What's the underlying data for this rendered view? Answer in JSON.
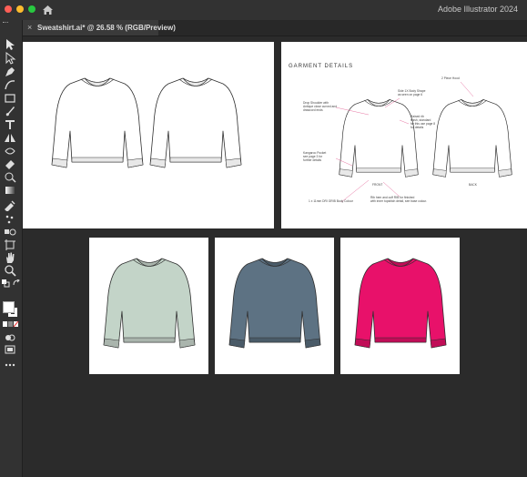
{
  "app": {
    "title": "Adobe Illustrator 2024"
  },
  "window": {
    "traffic_lights": [
      "close-red",
      "minimize-yellow",
      "zoom-green"
    ],
    "home_icon": "home-icon"
  },
  "tab": {
    "close_glyph": "×",
    "label": "Sweatshirt.ai* @ 26.58 % (RGB/Preview)"
  },
  "tools": [
    "selection-tool-icon",
    "direct-selection-tool-icon",
    "pen-tool-icon",
    "curvature-tool-icon",
    "rectangle-tool-icon",
    "paintbrush-tool-icon",
    "type-tool-icon",
    "reflect-tool-icon",
    "width-tool-icon",
    "eraser-tool-icon",
    "shape-builder-tool-icon",
    "gradient-tool-icon",
    "eyedropper-tool-icon",
    "symbol-sprayer-tool-icon",
    "blend-tool-icon",
    "artboard-tool-icon",
    "hand-tool-icon",
    "zoom-tool-icon",
    "default-colors-icon",
    "swap-colors-icon",
    "fill-swatch-icon",
    "stroke-swatch-icon",
    "color-mode-icon",
    "draw-mode-icon",
    "screen-mode-icon",
    "more-tools-icon"
  ],
  "garment_details": {
    "title": "GARMENT DETAILS",
    "callouts": [
      {
        "text": "2 Piece Hood"
      },
      {
        "text": "Side 1X Body Shape\nas seen on page 6"
      },
      {
        "text": "Drop Shoulder with\nAntique close curved and\ndrawcord ends"
      },
      {
        "text": "Raised rib\nfinish, standard\nfor this use page 8\nfor details"
      },
      {
        "text": "Kangaroo Pocket\nsee page 3 for\nfurther details"
      },
      {
        "text": "1 x 11mm DRI GRIB Body Colour"
      },
      {
        "text": "Rib hem and cuff RIB for finished\nwith inner topstitch detail, see base colour."
      }
    ],
    "view_labels": [
      "FRONT",
      "BACK"
    ]
  },
  "colorways": [
    {
      "name": "sage",
      "body": "#c3d4c8",
      "rib": "#aab5ad"
    },
    {
      "name": "slate",
      "body": "#5d7283",
      "rib": "#4a5b68"
    },
    {
      "name": "magenta",
      "body": "#e8116a",
      "rib": "#c00d57"
    }
  ]
}
